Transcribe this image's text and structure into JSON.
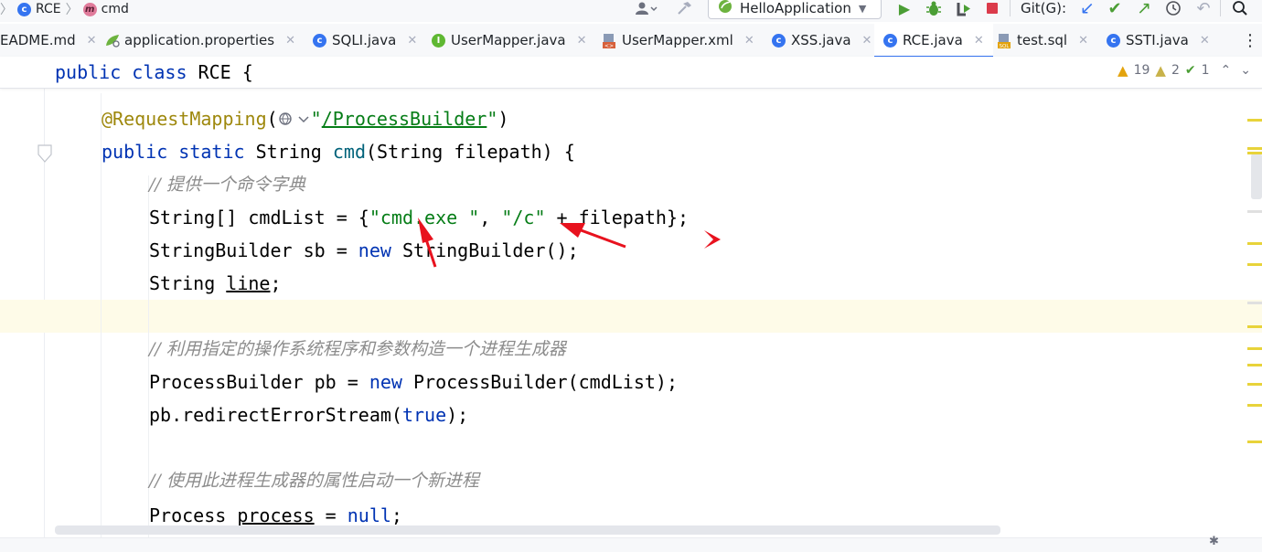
{
  "breadcrumb": {
    "class_name": "RCE",
    "method_name": "cmd"
  },
  "toolbar": {
    "run_config": "HelloApplication",
    "git_label": "Git(G):",
    "icons": [
      "user-icon",
      "hammer-icon",
      "run-icon",
      "debug-icon",
      "coverage-icon",
      "stop-icon",
      "update-icon",
      "commit-icon",
      "push-icon",
      "history-icon",
      "rollback-icon",
      "search-icon"
    ]
  },
  "tabs": [
    {
      "label": "EADME.md",
      "icon": "markdown"
    },
    {
      "label": "application.properties",
      "icon": "properties"
    },
    {
      "label": "SQLI.java",
      "icon": "class"
    },
    {
      "label": "UserMapper.java",
      "icon": "interface"
    },
    {
      "label": "UserMapper.xml",
      "icon": "xml"
    },
    {
      "label": "XSS.java",
      "icon": "class"
    },
    {
      "label": "RCE.java",
      "icon": "class",
      "active": true
    },
    {
      "label": "test.sql",
      "icon": "sql"
    },
    {
      "label": "SSTI.java",
      "icon": "class"
    }
  ],
  "inspections": {
    "warnings": "19",
    "weak_warnings": "2",
    "typos": "1"
  },
  "code": {
    "sticky": {
      "kw1": "public",
      "kw2": "class",
      "rest": " RCE {"
    },
    "l1": {
      "ann": "@RequestMapping",
      "open": "(",
      "path": "/ProcessBuilder",
      "q": "\"",
      "close": ")"
    },
    "l2": {
      "kw1": "public",
      "kw2": "static",
      "t": " String ",
      "fn": "cmd",
      "rest": "(String filepath) {"
    },
    "l3": "// 提供一个命令字典",
    "l4": {
      "a": "String[] cmdList = {",
      "s1": "\"cmd.exe \"",
      "b": ", ",
      "s2": "\"/c\"",
      "c": " + filepath};"
    },
    "l5": {
      "a": "StringBuilder sb = ",
      "kw": "new",
      "b": " StringBuilder();"
    },
    "l6": {
      "a": "String ",
      "v": "line",
      "b": ";"
    },
    "l7": "// 利用指定的操作系统程序和参数构造一个进程生成器",
    "l8": {
      "a": "ProcessBuilder pb = ",
      "kw": "new",
      "b": " ProcessBuilder(cmdList);"
    },
    "l9": {
      "a": "pb.redirectErrorStream(",
      "kw": "true",
      "b": ");"
    },
    "l10": "// 使用此进程生成器的属性启动一个新进程",
    "l11": {
      "a": "Process ",
      "v": "process",
      "b": " = ",
      "kw": "null",
      "c": ";"
    }
  }
}
